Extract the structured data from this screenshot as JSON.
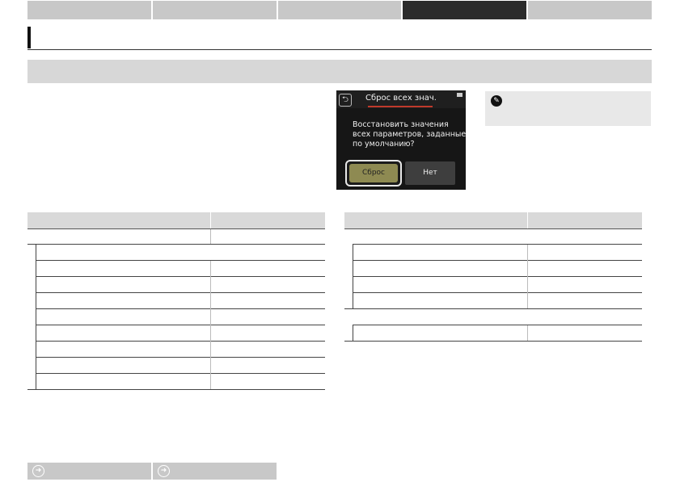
{
  "nav": {
    "tabs": [
      "",
      "",
      "",
      "",
      ""
    ],
    "active_index": 3
  },
  "camera": {
    "title": "Сброс всех знач.",
    "message_lines": [
      "Восстановить значения",
      "всех параметров, заданные",
      "по умолчанию?"
    ],
    "reset_button": "Сброс",
    "no_button": "Нет",
    "back_glyph": "⮌"
  },
  "icons": {
    "note": "pencil-icon",
    "back": "back-arrow-icon",
    "nav": "arrow-right-circle-icon"
  },
  "bottom_buttons": [
    "",
    ""
  ],
  "colors": {
    "active_tab": "#2b2b2b",
    "tab": "#c8c8c8",
    "reset_highlight": "#8e8a52",
    "title_underline": "#c0392b"
  }
}
